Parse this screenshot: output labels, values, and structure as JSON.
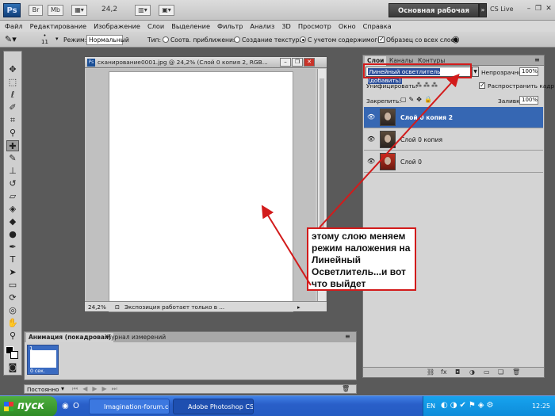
{
  "appbar": {
    "logo": "Ps",
    "br_label": "Br",
    "mb_label": "Mb",
    "zoom": "24,2",
    "workspace": "Основная рабочая среда",
    "cs_live": "CS Live"
  },
  "menu": [
    "Файл",
    "Редактирование",
    "Изображение",
    "Слои",
    "Выделение",
    "Фильтр",
    "Анализ",
    "3D",
    "Просмотр",
    "Окно",
    "Справка"
  ],
  "options": {
    "brush_size": "11",
    "mode_label": "Режим:",
    "mode_value": "Нормальный",
    "type_label": "Тип:",
    "opt1": "Соотв. приближения",
    "opt2": "Создание текстуры",
    "opt3": "С учетом содержимого",
    "sample_all": "Образец со всех слоев"
  },
  "document": {
    "title": "сканирование0001.jpg @ 24,2% (Слой 0 копия 2, RGB...",
    "zoom": "24,2%",
    "status": "Экспозиция работает только в ..."
  },
  "layers_panel": {
    "tabs": [
      "Слои",
      "Каналы",
      "Контуры"
    ],
    "blend_mode": "Линейный осветлитель (добавить)",
    "opacity_label": "Непрозрачность:",
    "opacity_value": "100%",
    "unify_label": "Унифицировать:",
    "propagate_label": "Распространить кадр 1",
    "lock_label": "Закрепить:",
    "fill_label": "Заливка:",
    "fill_value": "100%",
    "layers": [
      {
        "name": "Слой 0 копия 2",
        "selected": true
      },
      {
        "name": "Слой 0 копия",
        "selected": false
      },
      {
        "name": "Слой 0",
        "selected": false
      }
    ]
  },
  "animation_panel": {
    "tabs": [
      "Анимация (покадровая)",
      "Журнал измерений"
    ],
    "frame_number": "1",
    "frame_delay": "0 сек.",
    "loop": "Постоянно"
  },
  "annotation": {
    "text": "этому слою меняем режим наложения на Линейный Осветлитель...и вот что выйдет"
  },
  "taskbar": {
    "start": "пуск",
    "tasks": [
      "Imagination-forum.co...",
      "Adobe Photoshop CS..."
    ],
    "lang": "EN",
    "time": "12:25"
  },
  "colors": {
    "accent_red": "#d21b1b",
    "selection_blue": "#3667b3",
    "taskbar_blue": "#245bc2"
  }
}
